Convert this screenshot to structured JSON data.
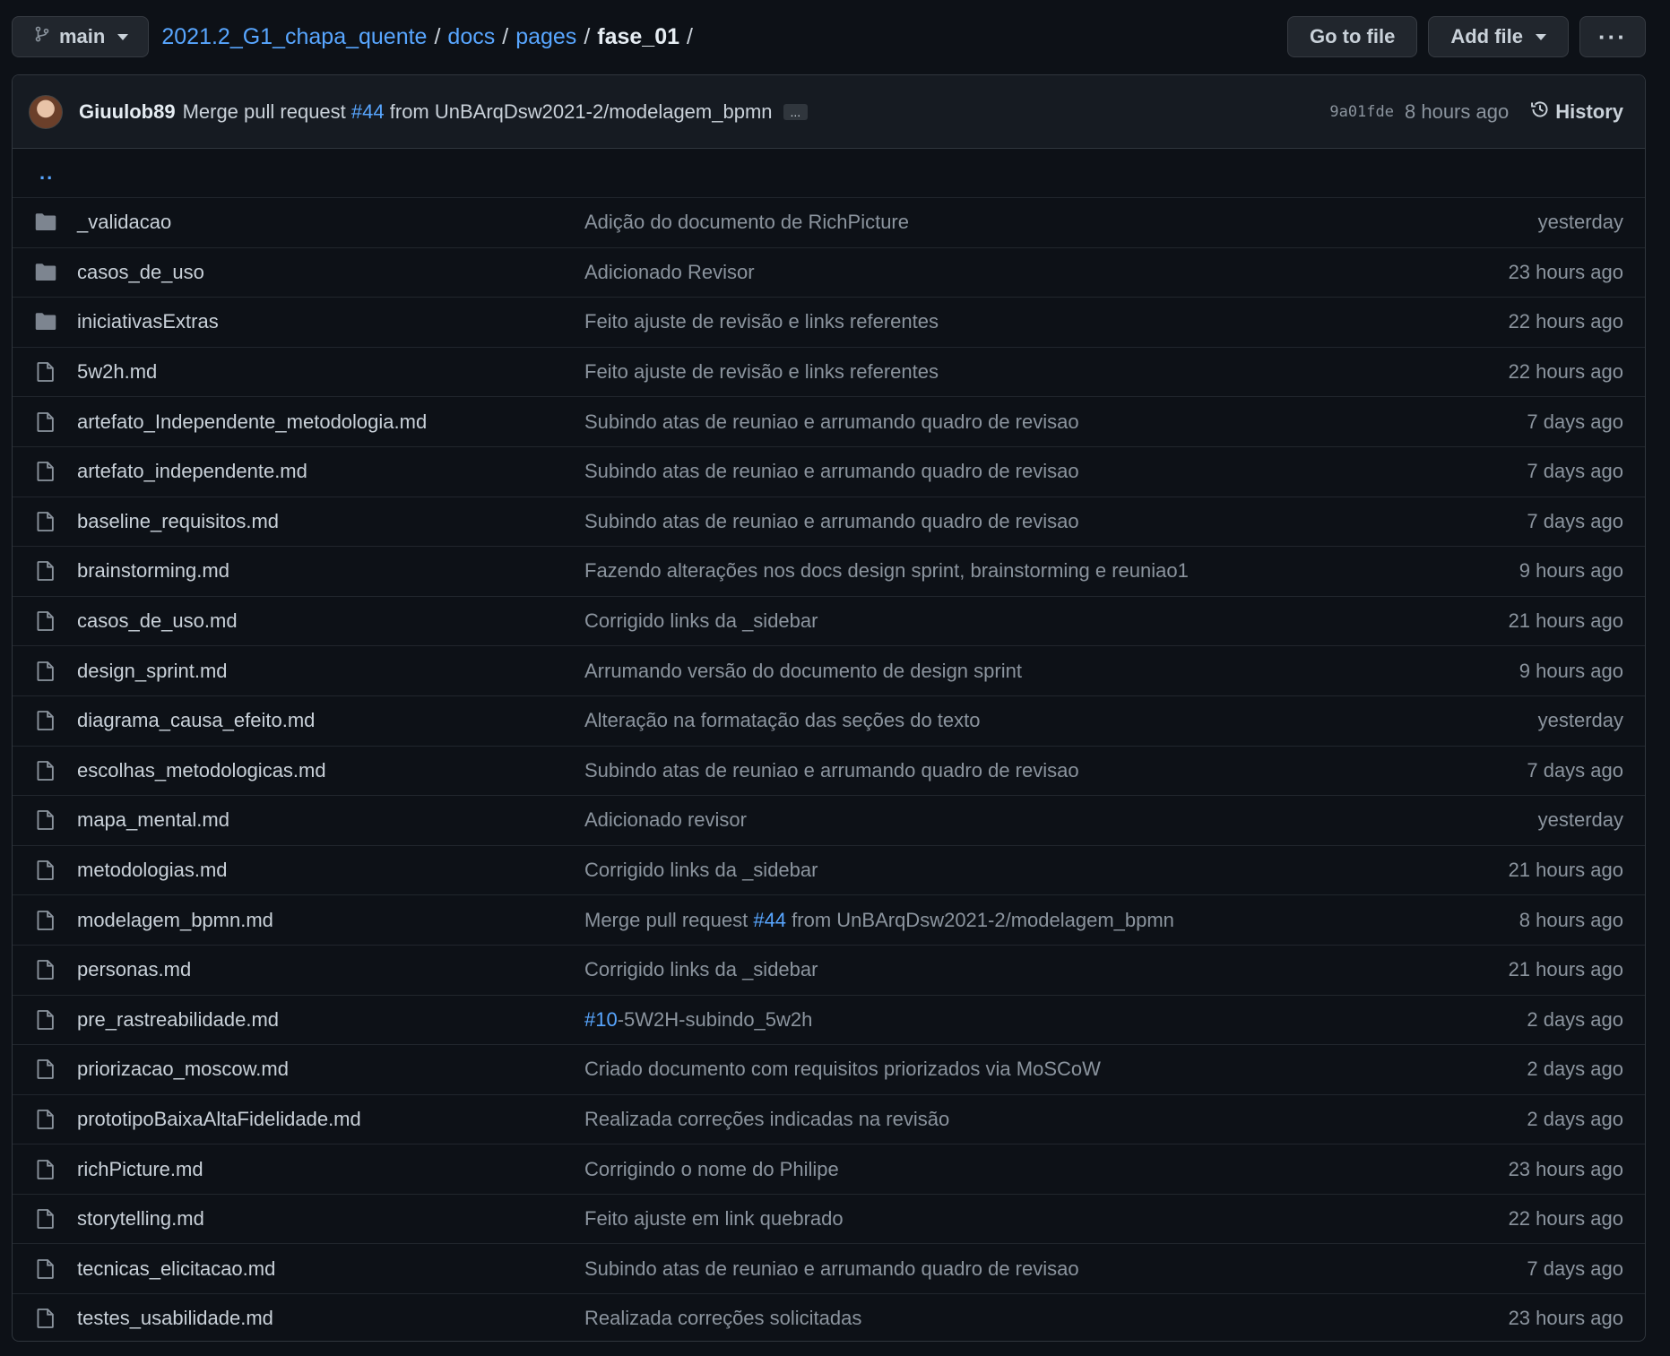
{
  "branch": {
    "name": "main"
  },
  "breadcrumb": {
    "repo": "2021.2_G1_chapa_quente",
    "parts": [
      "docs",
      "pages"
    ],
    "current": "fase_01",
    "sep": "/"
  },
  "actions": {
    "go_to_file": "Go to file",
    "add_file": "Add file",
    "more": "···"
  },
  "commit": {
    "author": "Giuulob89",
    "message_prefix": "Merge pull request",
    "pr": "#44",
    "message_suffix": "from UnBArqDsw2021-2/modelagem_bpmn",
    "ellipsis": "...",
    "sha": "9a01fde",
    "time": "8 hours ago",
    "history": "History"
  },
  "parent_link": "..",
  "files": [
    {
      "type": "dir",
      "name": "_validacao",
      "message": "Adição do documento de RichPicture",
      "age": "yesterday"
    },
    {
      "type": "dir",
      "name": "casos_de_uso",
      "message": "Adicionado Revisor",
      "age": "23 hours ago"
    },
    {
      "type": "dir",
      "name": "iniciativasExtras",
      "message": "Feito ajuste de revisão e links referentes",
      "age": "22 hours ago"
    },
    {
      "type": "file",
      "name": "5w2h.md",
      "message": "Feito ajuste de revisão e links referentes",
      "age": "22 hours ago"
    },
    {
      "type": "file",
      "name": "artefato_Independente_metodologia.md",
      "message": "Subindo atas de reuniao e arrumando quadro de revisao",
      "age": "7 days ago"
    },
    {
      "type": "file",
      "name": "artefato_independente.md",
      "message": "Subindo atas de reuniao e arrumando quadro de revisao",
      "age": "7 days ago"
    },
    {
      "type": "file",
      "name": "baseline_requisitos.md",
      "message": "Subindo atas de reuniao e arrumando quadro de revisao",
      "age": "7 days ago"
    },
    {
      "type": "file",
      "name": "brainstorming.md",
      "message": "Fazendo alterações nos docs design sprint, brainstorming e reuniao1",
      "age": "9 hours ago"
    },
    {
      "type": "file",
      "name": "casos_de_uso.md",
      "message": "Corrigido links da _sidebar",
      "age": "21 hours ago"
    },
    {
      "type": "file",
      "name": "design_sprint.md",
      "message": "Arrumando versão do documento de design sprint",
      "age": "9 hours ago"
    },
    {
      "type": "file",
      "name": "diagrama_causa_efeito.md",
      "message": "Alteração na formatação das seções do texto",
      "age": "yesterday"
    },
    {
      "type": "file",
      "name": "escolhas_metodologicas.md",
      "message": "Subindo atas de reuniao e arrumando quadro de revisao",
      "age": "7 days ago"
    },
    {
      "type": "file",
      "name": "mapa_mental.md",
      "message": "Adicionado revisor",
      "age": "yesterday"
    },
    {
      "type": "file",
      "name": "metodologias.md",
      "message": "Corrigido links da _sidebar",
      "age": "21 hours ago"
    },
    {
      "type": "file",
      "name": "modelagem_bpmn.md",
      "message_prefix": "Merge pull request ",
      "link": "#44",
      "message_suffix": " from UnBArqDsw2021-2/modelagem_bpmn",
      "age": "8 hours ago"
    },
    {
      "type": "file",
      "name": "personas.md",
      "message": "Corrigido links da _sidebar",
      "age": "21 hours ago"
    },
    {
      "type": "file",
      "name": "pre_rastreabilidade.md",
      "message_prefix": "",
      "link": "#10",
      "message_suffix": "-5W2H-subindo_5w2h",
      "age": "2 days ago"
    },
    {
      "type": "file",
      "name": "priorizacao_moscow.md",
      "message": "Criado documento com requisitos priorizados via MoSCoW",
      "age": "2 days ago"
    },
    {
      "type": "file",
      "name": "prototipoBaixaAltaFidelidade.md",
      "message": "Realizada correções indicadas na revisão",
      "age": "2 days ago"
    },
    {
      "type": "file",
      "name": "richPicture.md",
      "message": "Corrigindo o nome do Philipe",
      "age": "23 hours ago"
    },
    {
      "type": "file",
      "name": "storytelling.md",
      "message": "Feito ajuste em link quebrado",
      "age": "22 hours ago"
    },
    {
      "type": "file",
      "name": "tecnicas_elicitacao.md",
      "message": "Subindo atas de reuniao e arrumando quadro de revisao",
      "age": "7 days ago"
    },
    {
      "type": "file",
      "name": "testes_usabilidade.md",
      "message": "Realizada correções solicitadas",
      "age": "23 hours ago"
    }
  ],
  "colors": {
    "bg": "#0d1117",
    "link": "#58a6ff",
    "muted": "#8b949e",
    "folder": "#7d8590"
  }
}
